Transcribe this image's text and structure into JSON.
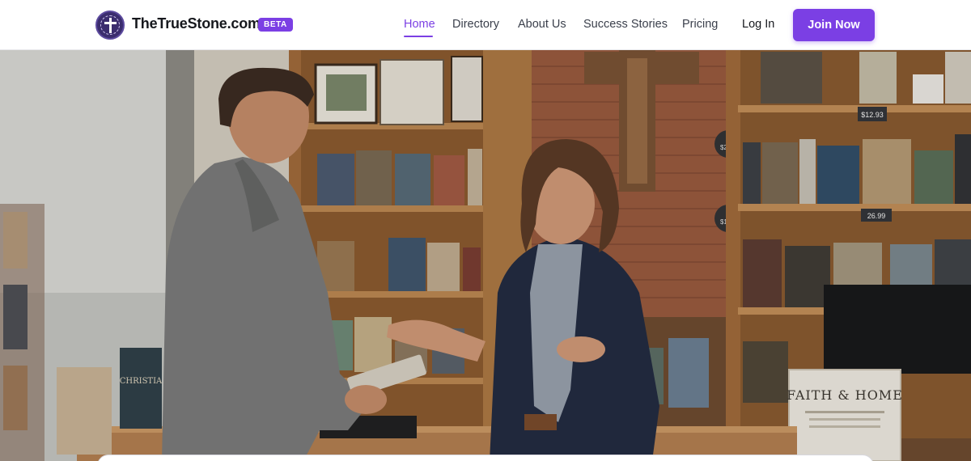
{
  "brand": {
    "name": "TheTrueStone.com",
    "badge": "BETA",
    "logo_icon": "cross-seal-icon"
  },
  "nav": {
    "items": [
      {
        "label": "Home",
        "active": true
      },
      {
        "label": "Directory",
        "active": false
      },
      {
        "label": "About Us",
        "active": false
      },
      {
        "label": "Success Stories",
        "active": false
      },
      {
        "label": "Pricing",
        "active": false
      }
    ],
    "login_label": "Log In",
    "cta_label": "Join Now"
  },
  "hero": {
    "price_tags": [
      {
        "line": "$2.89"
      },
      {
        "line": "$1.80"
      },
      {
        "line": "$12.93"
      },
      {
        "line": "26.99"
      }
    ],
    "sign_title": "FAITH & HOME",
    "book_cover_text": "CHRISTIA"
  },
  "colors": {
    "accent": "#7b3fe4",
    "brand_dark": "#16181d"
  }
}
